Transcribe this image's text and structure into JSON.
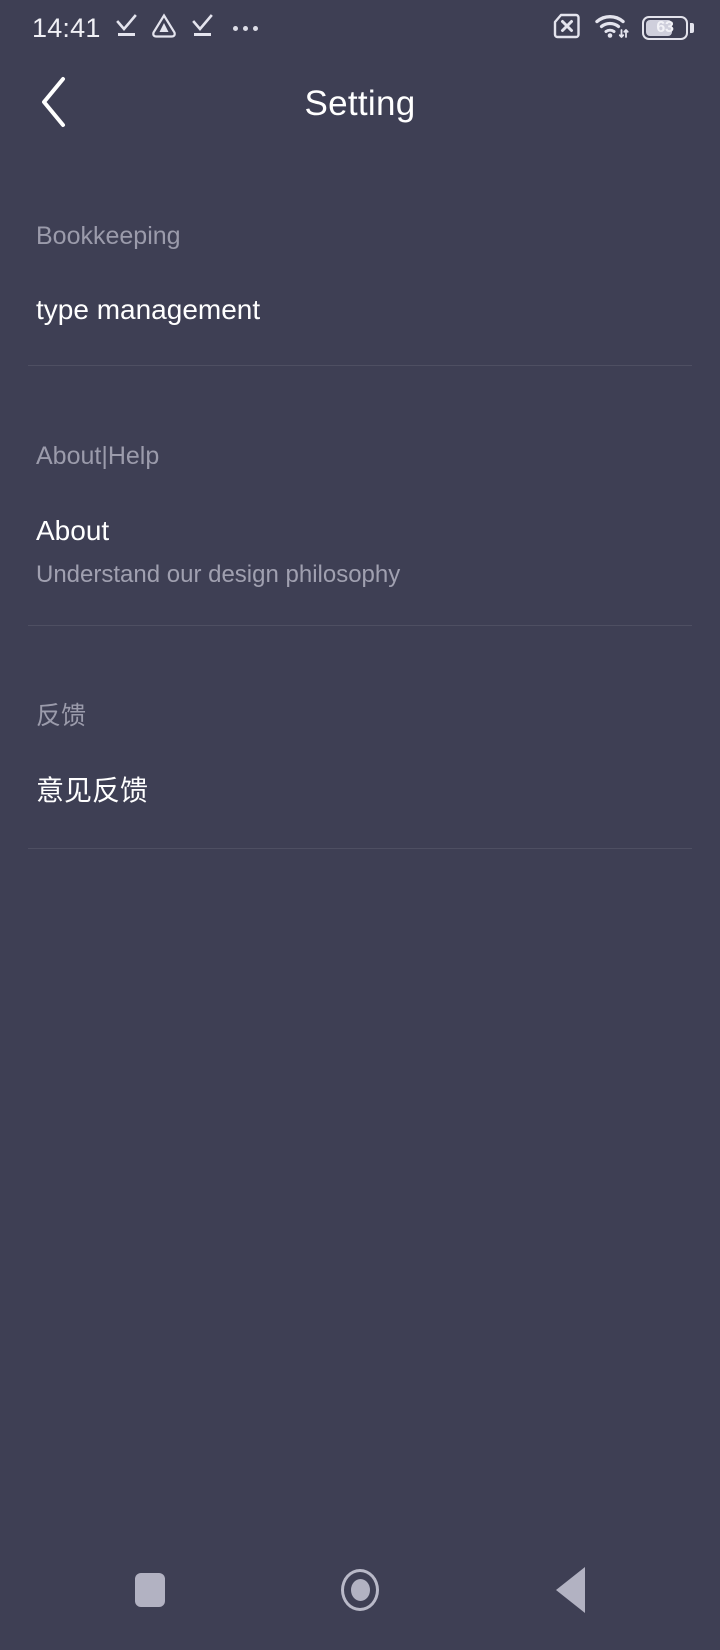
{
  "status_bar": {
    "time": "14:41",
    "left_icons": [
      "download-complete-icon",
      "app-triangle-icon",
      "download-complete-icon",
      "more-dots-icon"
    ],
    "right_icons": [
      "no-sim-icon",
      "wifi-icon"
    ],
    "battery_level": "63"
  },
  "header": {
    "title": "Setting",
    "back_icon": "chevron-left-icon"
  },
  "sections": [
    {
      "header": "Bookkeeping",
      "rows": [
        {
          "title": "type management",
          "subtitle": ""
        }
      ]
    },
    {
      "header": "About|Help",
      "rows": [
        {
          "title": "About",
          "subtitle": "Understand our design philosophy"
        }
      ]
    },
    {
      "header": "反馈",
      "rows": [
        {
          "title": "意见反馈",
          "subtitle": ""
        }
      ]
    }
  ],
  "nav_bar": {
    "recents": "recents-square-icon",
    "home": "home-circle-icon",
    "back": "back-triangle-icon"
  },
  "colors": {
    "background": "#3e3f54",
    "primary_text": "#ffffff",
    "secondary_text": "#9b9bab",
    "divider": "rgba(255,255,255,0.085)"
  }
}
